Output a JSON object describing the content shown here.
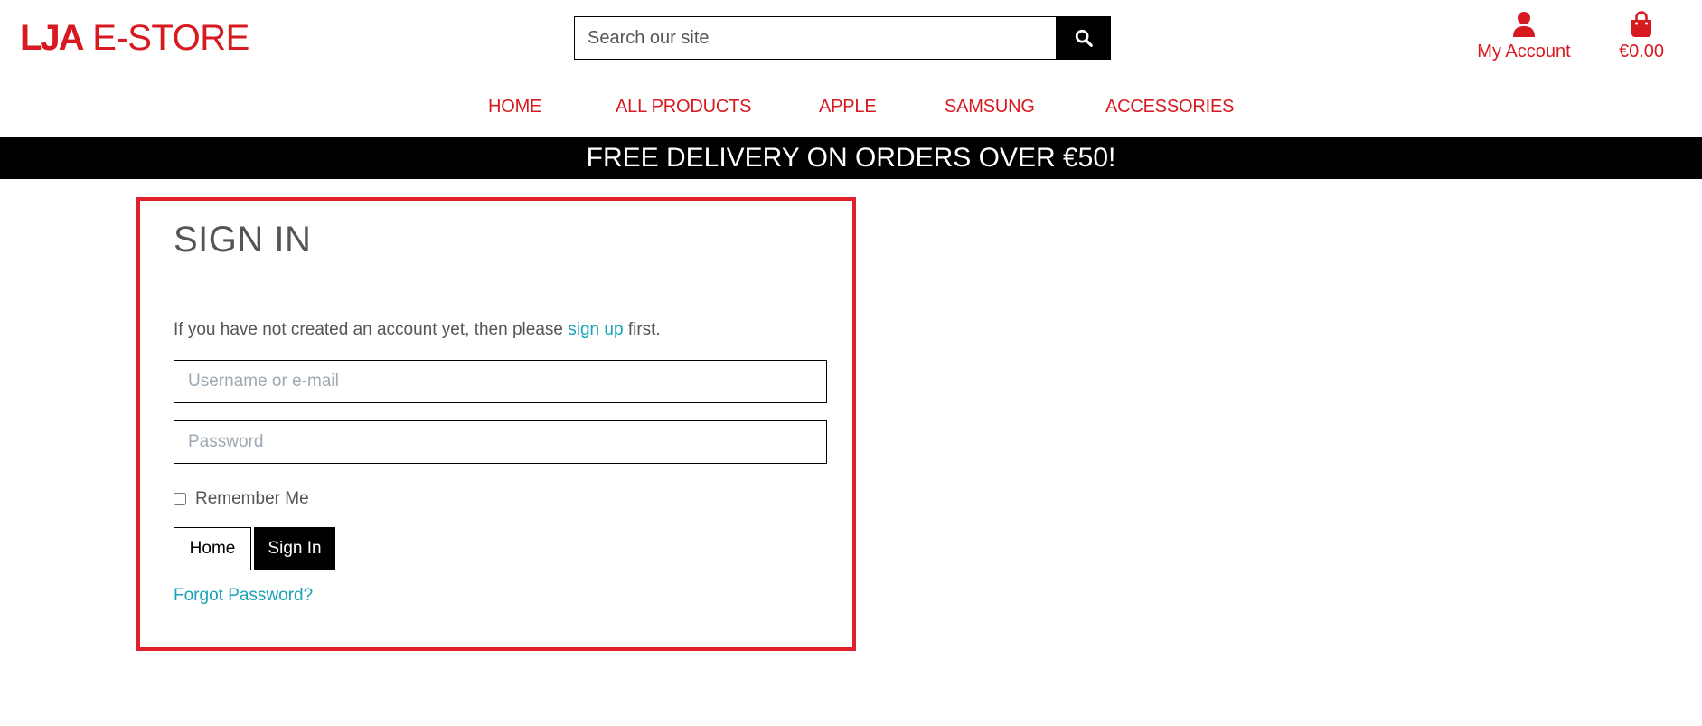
{
  "header": {
    "logo_strong": "LJA",
    "logo_rest": "E-STORE",
    "search_placeholder": "Search our site",
    "account_label": "My Account",
    "bag_total": "€0.00"
  },
  "nav": {
    "items": [
      {
        "label": "HOME"
      },
      {
        "label": "ALL PRODUCTS"
      },
      {
        "label": "APPLE"
      },
      {
        "label": "SAMSUNG"
      },
      {
        "label": "ACCESSORIES"
      }
    ]
  },
  "banner": {
    "text": "FREE DELIVERY ON ORDERS OVER €50!"
  },
  "signin": {
    "title": "SIGN IN",
    "intro_before": "If you have not created an account yet, then please",
    "intro_link": "sign up",
    "intro_after": "first.",
    "username_placeholder": "Username or e-mail",
    "password_placeholder": "Password",
    "remember_label": "Remember Me",
    "remember_checked": false,
    "home_button": "Home",
    "signin_button": "Sign In",
    "forgot_link": "Forgot Password?"
  },
  "colors": {
    "brand_red": "#d71920",
    "card_border": "#e0212b",
    "link_teal": "#17a2b8",
    "banner_bg": "#000000"
  },
  "icons": {
    "search": "search-icon",
    "account": "user-icon",
    "bag": "shopping-bag-icon"
  }
}
